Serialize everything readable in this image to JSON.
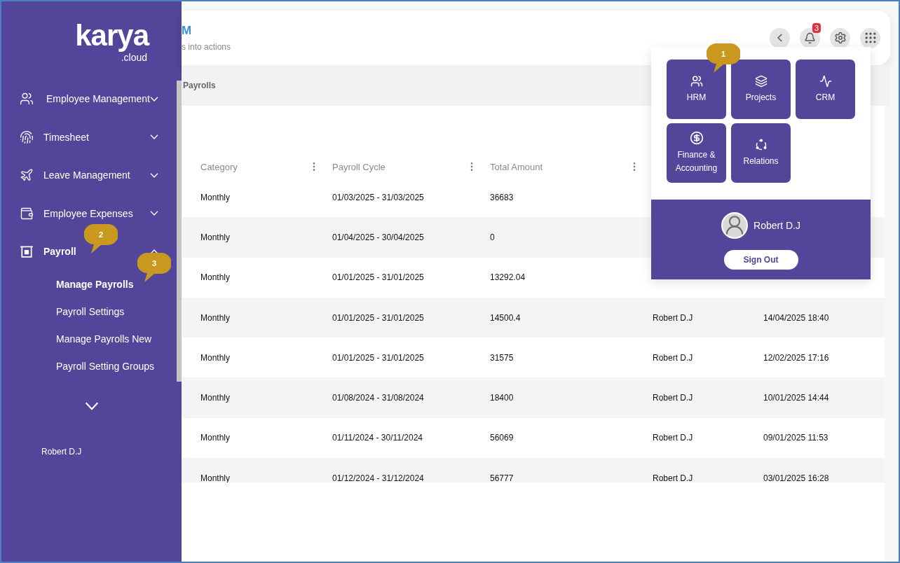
{
  "sidebar": {
    "logo": {
      "name": "karya",
      "suffix": ".cloud"
    },
    "nav": [
      {
        "label": "Employee Management",
        "expanded": false,
        "selected": false
      },
      {
        "label": "Timesheet",
        "expanded": false,
        "selected": false
      },
      {
        "label": "Leave Management",
        "expanded": false,
        "selected": false
      },
      {
        "label": "Employee Expenses",
        "expanded": false,
        "selected": false
      },
      {
        "label": "Payroll",
        "expanded": true,
        "selected": true,
        "children": [
          {
            "label": "Manage Payrolls",
            "selected": true
          },
          {
            "label": "Payroll Settings",
            "selected": false
          },
          {
            "label": "Manage Payrolls New",
            "selected": false
          },
          {
            "label": "Payroll Setting Groups",
            "selected": false
          }
        ]
      }
    ],
    "user": "Robert D.J"
  },
  "header": {
    "title": "M",
    "subtitle": "s into actions",
    "notification_count": "3"
  },
  "breadcrumb": "Payrolls",
  "table": {
    "columns": [
      "Category",
      "Payroll Cycle",
      "Total Amount"
    ],
    "rows": [
      {
        "category": "Monthly",
        "payroll_cycle": "01/03/2025 - 31/03/2025",
        "total_amount": "36683"
      },
      {
        "category": "Monthly",
        "payroll_cycle": "01/04/2025 - 30/04/2025",
        "total_amount": "0"
      },
      {
        "category": "Monthly",
        "payroll_cycle": "01/01/2025 - 31/01/2025",
        "total_amount": "13292.04"
      },
      {
        "category": "Monthly",
        "payroll_cycle": "01/01/2025 - 31/01/2025",
        "total_amount": "14500.4",
        "column_4": "Robert D.J",
        "column_5": "14/04/2025 18:40"
      },
      {
        "category": "Monthly",
        "payroll_cycle": "01/01/2025 - 31/01/2025",
        "total_amount": "31575",
        "column_4": "Robert D.J",
        "column_5": "12/02/2025 17:16"
      },
      {
        "category": "Monthly",
        "payroll_cycle": "01/08/2024 - 31/08/2024",
        "total_amount": "18400",
        "column_4": "Robert D.J",
        "column_5": "10/01/2025 14:44"
      },
      {
        "category": "Monthly",
        "payroll_cycle": "01/11/2024 - 30/11/2024",
        "total_amount": "56069",
        "column_4": "Robert D.J",
        "column_5": "09/01/2025 11:53"
      },
      {
        "category": "Monthly",
        "payroll_cycle": "01/12/2024 - 31/12/2024",
        "total_amount": "56777",
        "column_4": "Robert D.J",
        "column_5": "03/01/2025 16:28"
      }
    ]
  },
  "apps_menu": {
    "apps": [
      {
        "label": "HRM"
      },
      {
        "label": "Projects"
      },
      {
        "label": "CRM"
      },
      {
        "label": "Finance & Accounting"
      },
      {
        "label": "Relations"
      }
    ],
    "user": "Robert D.J",
    "sign_out": "Sign Out"
  },
  "callouts": [
    {
      "label": "1"
    },
    {
      "label": "2"
    },
    {
      "label": "3"
    }
  ]
}
